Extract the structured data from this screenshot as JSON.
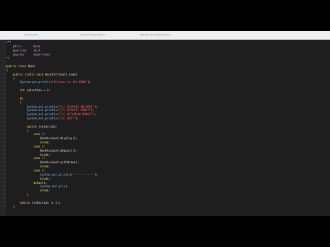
{
  "tabs": [
    {
      "label": "Bank.java"
    },
    {
      "label": "BankAccount.java"
    },
    {
      "label": "BankInformation.java"
    }
  ],
  "lines": [
    {
      "n": "1",
      "segs": [
        {
          "t": "/**",
          "c": "com"
        }
      ]
    },
    {
      "n": "2",
      "segs": [
        {
          "t": "    @file       Bank",
          "c": "com"
        }
      ]
    },
    {
      "n": "3",
      "segs": [
        {
          "t": "    @version    v0.6",
          "c": "com"
        }
      ]
    },
    {
      "n": "4",
      "segs": [
        {
          "t": "    @author     Soberfreen",
          "c": "com"
        }
      ]
    },
    {
      "n": "5",
      "segs": [
        {
          "t": "*/",
          "c": "com"
        }
      ]
    },
    {
      "n": "6",
      "segs": []
    },
    {
      "n": "7",
      "segs": [
        {
          "t": "public class ",
          "c": "kw"
        },
        {
          "t": "Bank",
          "c": ""
        }
      ]
    },
    {
      "n": "8",
      "segs": [
        {
          "t": "{",
          "c": ""
        }
      ]
    },
    {
      "n": "9",
      "segs": [
        {
          "t": "    ",
          "c": ""
        },
        {
          "t": "public static void ",
          "c": "kw"
        },
        {
          "t": "main(",
          "c": ""
        },
        {
          "t": "String",
          "c": "kw"
        },
        {
          "t": "[] args)",
          "c": ""
        }
      ]
    },
    {
      "n": "10",
      "segs": [
        {
          "t": "    {",
          "c": ""
        }
      ]
    },
    {
      "n": "11",
      "segs": [
        {
          "t": "        ",
          "c": ""
        },
        {
          "t": "System.out.println",
          "c": "fn"
        },
        {
          "t": "(",
          "c": ""
        },
        {
          "t": "\"Welcome to the BANK\"",
          "c": "str"
        },
        {
          "t": ");",
          "c": ""
        }
      ]
    },
    {
      "n": "12",
      "segs": []
    },
    {
      "n": "13",
      "segs": [
        {
          "t": "        ",
          "c": ""
        },
        {
          "t": "int ",
          "c": "kw"
        },
        {
          "t": "selection = ",
          "c": ""
        },
        {
          "t": "0",
          "c": "num"
        },
        {
          "t": ";",
          "c": ""
        }
      ]
    },
    {
      "n": "14",
      "segs": []
    },
    {
      "n": "15",
      "segs": [
        {
          "t": "        ",
          "c": ""
        },
        {
          "t": "do",
          "c": "kw"
        }
      ]
    },
    {
      "n": "16",
      "segs": [
        {
          "t": "        {",
          "c": ""
        }
      ]
    },
    {
      "n": "17",
      "segs": [
        {
          "t": "            ",
          "c": ""
        },
        {
          "t": "System.out.println",
          "c": "fn"
        },
        {
          "t": "(",
          "c": ""
        },
        {
          "t": "\"[1] DISPLAY BALANCE\"",
          "c": "str"
        },
        {
          "t": ");",
          "c": ""
        }
      ]
    },
    {
      "n": "18",
      "segs": [
        {
          "t": "            ",
          "c": ""
        },
        {
          "t": "System.out.println",
          "c": "fn"
        },
        {
          "t": "(",
          "c": ""
        },
        {
          "t": "\"[2] DEPOSIT MONEY\"",
          "c": "str"
        },
        {
          "t": ");",
          "c": ""
        }
      ]
    },
    {
      "n": "19",
      "segs": [
        {
          "t": "            ",
          "c": ""
        },
        {
          "t": "System.out.println",
          "c": "fn"
        },
        {
          "t": "(",
          "c": ""
        },
        {
          "t": "\"[3] WITHDRAW MONEY\"",
          "c": "str"
        },
        {
          "t": ");",
          "c": ""
        }
      ]
    },
    {
      "n": "20",
      "segs": [
        {
          "t": "            ",
          "c": ""
        },
        {
          "t": "System.out.println",
          "c": "fn"
        },
        {
          "t": "(",
          "c": ""
        },
        {
          "t": "\"[4] QUIT\"",
          "c": "str"
        },
        {
          "t": ");",
          "c": ""
        }
      ]
    },
    {
      "n": "21",
      "segs": []
    },
    {
      "n": "22",
      "segs": [
        {
          "t": "            ",
          "c": ""
        },
        {
          "t": "switch",
          "c": "kw"
        },
        {
          "t": " (selection)",
          "c": ""
        }
      ]
    },
    {
      "n": "23",
      "segs": [
        {
          "t": "            {",
          "c": ""
        }
      ]
    },
    {
      "n": "24",
      "segs": [
        {
          "t": "                ",
          "c": ""
        },
        {
          "t": "case ",
          "c": "kw"
        },
        {
          "t": "1",
          "c": "num"
        },
        {
          "t": ":",
          "c": ""
        }
      ]
    },
    {
      "n": "25",
      "segs": [
        {
          "t": "                    BankAccount.display();",
          "c": ""
        }
      ]
    },
    {
      "n": "26",
      "segs": [
        {
          "t": "                    ",
          "c": ""
        },
        {
          "t": "break",
          "c": "kw"
        },
        {
          "t": ";",
          "c": ""
        }
      ]
    },
    {
      "n": "27",
      "segs": [
        {
          "t": "                ",
          "c": ""
        },
        {
          "t": "case ",
          "c": "kw"
        },
        {
          "t": "2",
          "c": "num"
        },
        {
          "t": ":",
          "c": ""
        }
      ]
    },
    {
      "n": "28",
      "segs": [
        {
          "t": "                    BankAccount.deposit();",
          "c": ""
        }
      ]
    },
    {
      "n": "29",
      "segs": [
        {
          "t": "                    ",
          "c": ""
        },
        {
          "t": "break",
          "c": "kw"
        },
        {
          "t": ";",
          "c": ""
        }
      ]
    },
    {
      "n": "30",
      "segs": [
        {
          "t": "                ",
          "c": ""
        },
        {
          "t": "case ",
          "c": "kw"
        },
        {
          "t": "3",
          "c": "num"
        },
        {
          "t": ":",
          "c": ""
        }
      ]
    },
    {
      "n": "31",
      "segs": [
        {
          "t": "                    BankAccount.withdraw();",
          "c": ""
        }
      ]
    },
    {
      "n": "32",
      "segs": [
        {
          "t": "                    ",
          "c": ""
        },
        {
          "t": "break",
          "c": "kw"
        },
        {
          "t": ";",
          "c": ""
        }
      ]
    },
    {
      "n": "33",
      "segs": [
        {
          "t": "                ",
          "c": ""
        },
        {
          "t": "case ",
          "c": "kw"
        },
        {
          "t": "4",
          "c": "num"
        },
        {
          "t": ":",
          "c": ""
        }
      ]
    },
    {
      "n": "34",
      "segs": [
        {
          "t": "                    ",
          "c": ""
        },
        {
          "t": "System.out.println",
          "c": "fn"
        },
        {
          "t": "(",
          "c": ""
        },
        {
          "t": "\"-----------\"",
          "c": "str"
        },
        {
          "t": ");",
          "c": ""
        }
      ]
    },
    {
      "n": "35",
      "segs": [
        {
          "t": "                    ",
          "c": ""
        },
        {
          "t": "break",
          "c": "kw"
        },
        {
          "t": ";",
          "c": ""
        }
      ]
    },
    {
      "n": "36",
      "segs": [
        {
          "t": "                ",
          "c": ""
        },
        {
          "t": "default",
          "c": "kw"
        },
        {
          "t": ":",
          "c": ""
        }
      ]
    },
    {
      "n": "37",
      "segs": [
        {
          "t": "                    ",
          "c": ""
        },
        {
          "t": "System.out.prin",
          "c": "fn"
        },
        {
          "t": "|",
          "c": ""
        }
      ]
    },
    {
      "n": "38",
      "segs": [
        {
          "t": "                    ",
          "c": ""
        },
        {
          "t": "break",
          "c": "kw"
        },
        {
          "t": ";",
          "c": ""
        }
      ]
    },
    {
      "n": "39",
      "segs": [
        {
          "t": "            }",
          "c": ""
        }
      ]
    },
    {
      "n": "40",
      "segs": []
    },
    {
      "n": "41",
      "segs": [
        {
          "t": "        }",
          "c": ""
        },
        {
          "t": "while",
          "c": "kw"
        },
        {
          "t": " (selection != ",
          "c": ""
        },
        {
          "t": "4",
          "c": "num"
        },
        {
          "t": ");",
          "c": ""
        }
      ]
    },
    {
      "n": "42",
      "segs": [
        {
          "t": "    }",
          "c": ""
        }
      ]
    }
  ]
}
